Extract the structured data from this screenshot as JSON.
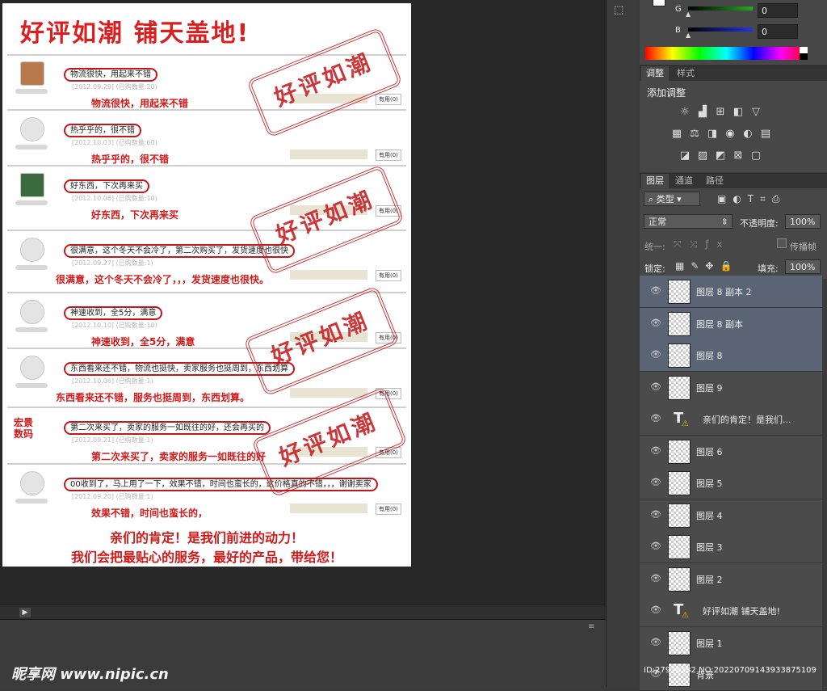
{
  "document": {
    "title": "好评如潮  铺天盖地!",
    "stamp_text": "好评如潮",
    "reviews": [
      {
        "text": "物流很快，用起来不错",
        "meta": "[2012.09.29]  (已购数量:20)",
        "caption": "物流很快，用起来不错",
        "useful": "有用(0)"
      },
      {
        "text": "热乎乎的，很不错",
        "meta": "[2012.10.03]  (已购数量:60)",
        "caption": "热乎乎的，很不错",
        "useful": "有用(0)"
      },
      {
        "text": "好东西，下次再来买",
        "meta": "[2012.10.06]  (已购数量:10)",
        "caption": "好东西，下次再来买",
        "useful": "有用(0)"
      },
      {
        "text": "很满意，这个冬天不会冷了，第二次购买了，发货速度也很快",
        "meta": "[2012.09.27]  (已购数量:1)",
        "caption": "很满意，这个冬天不会冷了，，，发货速度也很快。",
        "useful": "有用(0)"
      },
      {
        "text": "神速收到，全5分，满意",
        "meta": "[2012.10.10]  (已购数量:10)",
        "caption": "神速收到，全5分，满意",
        "useful": "有用(0)"
      },
      {
        "text": "东西看来还不错，物流也挺快，卖家服务也挺周到，东西划算",
        "meta": "[2012.10.06]  (已购数量:1)",
        "caption": "东西看来还不错，服务也挺周到，东西划算。",
        "useful": "有用(0)"
      },
      {
        "text": "第二次来买了，卖家的服务一如既往的好，还会再买的",
        "meta": "[2012.09.21]  (已购数量:1)",
        "caption": "第二次来买了，卖家的服务一如既往的好",
        "useful": "有用(0)"
      },
      {
        "text": "00收到了，马上用了一下，效果不错，时间也蛮长的，这价格真的不错，，，谢谢卖家",
        "meta": "[2012.09.20]  (已购数量:1)",
        "caption": "效果不错，时间也蛮长的，",
        "useful": "有用(0)"
      }
    ],
    "footer_line1": "亲们的肯定！是我们前进的动力！",
    "footer_line2": "我们会把最贴心的服务，最好的产品，带给您！",
    "logo_text": "宏景\n数码"
  },
  "watermark": "昵享网 www.nipic.cn",
  "id_text": "ID:27926582 NO:20220709143933875109",
  "color_panel": {
    "channels": [
      {
        "label": "G",
        "value": "0",
        "color": "#22aa22"
      },
      {
        "label": "B",
        "value": "0",
        "color": "#2233dd"
      }
    ]
  },
  "adjustments": {
    "tabs": [
      "调整",
      "样式"
    ],
    "heading": "添加调整",
    "icons": [
      "brightness-icon",
      "curves-icon",
      "levels-icon",
      "exposure-icon",
      "vibrance-icon",
      "hue-icon",
      "balance-icon",
      "bw-icon",
      "photo-filter-icon",
      "channel-mixer-icon",
      "color-lookup-icon",
      "invert-icon",
      "posterize-icon",
      "threshold-icon",
      "gradient-map-icon",
      "selective-color-icon"
    ]
  },
  "layers_panel": {
    "tabs": [
      "图层",
      "通道",
      "路径"
    ],
    "filter_kind": "类型",
    "blend_mode": "正常",
    "opacity_label": "不透明度:",
    "opacity_value": "100%",
    "unify_label": "统一:",
    "propagate_label": "传播帧",
    "lock_label": "锁定:",
    "fill_label": "填充:",
    "fill_value": "100%",
    "layers": [
      {
        "name": "图层 8 副本 2",
        "type": "pixel",
        "selected": true
      },
      {
        "name": "图层 8 副本",
        "type": "pixel",
        "selected": true
      },
      {
        "name": "图层 8",
        "type": "pixel",
        "selected": true
      },
      {
        "name": "图层 9",
        "type": "pixel",
        "selected": false
      },
      {
        "name": "亲们的肯定！是我们...",
        "type": "text",
        "selected": false
      },
      {
        "name": "图层 6",
        "type": "pixel",
        "selected": false
      },
      {
        "name": "图层 5",
        "type": "pixel",
        "selected": false
      },
      {
        "name": "图层 4",
        "type": "pixel",
        "selected": false
      },
      {
        "name": "图层 3",
        "type": "pixel",
        "selected": false
      },
      {
        "name": "图层 2",
        "type": "pixel",
        "selected": false
      },
      {
        "name": "好评如潮 铺天盖地!",
        "type": "text",
        "selected": false
      },
      {
        "name": "图层 1",
        "type": "pixel",
        "selected": false
      },
      {
        "name": "背景",
        "type": "pixel",
        "selected": false
      }
    ]
  }
}
